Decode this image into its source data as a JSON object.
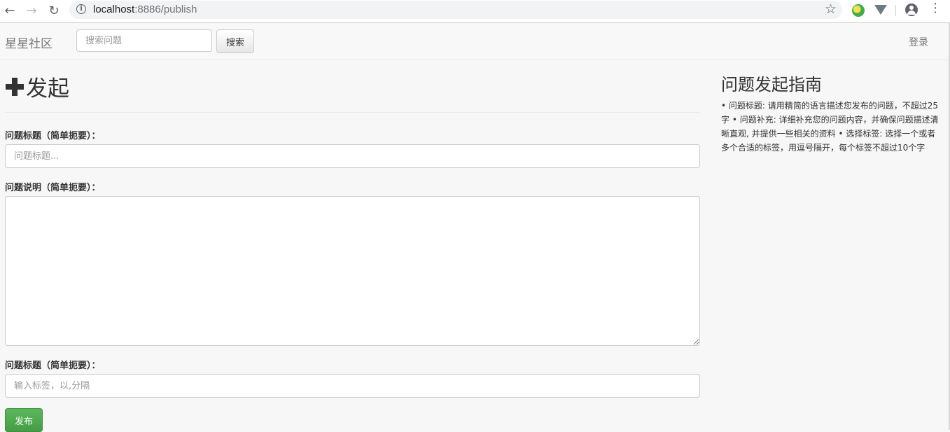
{
  "browser": {
    "url_host": "localhost",
    "url_path": ":8886/publish",
    "back_icon": "←",
    "forward_icon": "→",
    "reload_icon": "↻",
    "info_icon": "i",
    "star_icon": "☆",
    "menu_icon": "⋮"
  },
  "navbar": {
    "brand": "星星社区",
    "search_placeholder": "搜索问题",
    "search_button": "搜索",
    "login": "登录"
  },
  "main": {
    "title": "发起",
    "fields": {
      "title_label": "问题标题（简单扼要）：",
      "title_placeholder": "问题标题...",
      "description_label": "问题说明（简单扼要）：",
      "tag_label": "问题标题（简单扼要）：",
      "tag_placeholder": "输入标签，以,分隔"
    },
    "publish_button": "发布"
  },
  "guide": {
    "title": "问题发起指南",
    "text": "• 问题标题: 请用精简的语言描述您发布的问题，不超过25字 • 问题补充: 详细补充您的问题内容，并确保问题描述清晰直观, 并提供一些相关的资料 • 选择标签: 选择一个或者多个合适的标签，用逗号隔开，每个标签不超过10个字"
  },
  "colors": {
    "publish_green": "#5cb85c",
    "page_background": "#f7f7f7"
  }
}
